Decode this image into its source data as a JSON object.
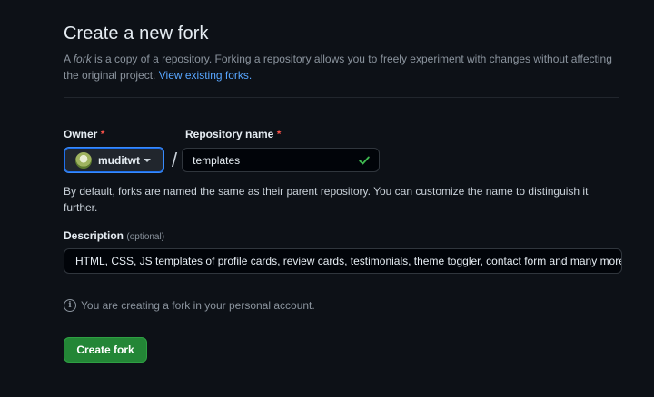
{
  "header": {
    "title": "Create a new fork",
    "subtitle_prefix": "A ",
    "subtitle_em": "fork",
    "subtitle_main": " is a copy of a repository. Forking a repository allows you to freely experiment with changes without affecting the original project. ",
    "view_forks_link": "View existing forks."
  },
  "owner": {
    "label": "Owner",
    "required_mark": "*",
    "name": "muditwt",
    "avatar_icon": "user-avatar",
    "caret_icon": "chevron-down-icon"
  },
  "separator": "/",
  "repository": {
    "label": "Repository name",
    "required_mark": "*",
    "value": "templates",
    "valid_icon": "check-icon",
    "valid_color": "#3fb950"
  },
  "hint": "By default, forks are named the same as their parent repository. You can customize the name to distinguish it further.",
  "description": {
    "label": "Description",
    "optional_label": "(optional)",
    "value": "HTML, CSS, JS templates of profile cards, review cards, testimonials, theme toggler, contact form and many more"
  },
  "info": {
    "icon": "info-icon",
    "text": "You are creating a fork in your personal account."
  },
  "actions": {
    "create_label": "Create fork",
    "create_color": "#238636"
  },
  "colors": {
    "background": "#0d1117",
    "link": "#58a6ff",
    "required": "#f85149",
    "focus_border": "#388bfd"
  }
}
